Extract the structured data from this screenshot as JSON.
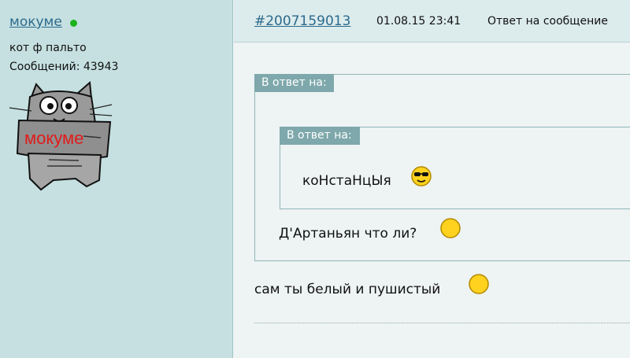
{
  "user": {
    "name": "мокуме",
    "title": "кот ф пальто",
    "posts": "Сообщений: 43943",
    "avatar_text": "мокуме"
  },
  "post": {
    "id": "#2007159013",
    "date": "01.08.15 23:41",
    "reply": "Ответ на сообщение"
  },
  "quotes": {
    "outer_label": "В ответ на:",
    "inner_label": "В ответ на:",
    "inner_text": "коНстаНцЫя",
    "outer_text": "Д'Артаньян что ли?"
  },
  "body_text": "сам ты белый и пушистый",
  "icons": {
    "online": "online-status-dot",
    "cool": "sunglasses-smiley-icon",
    "smile": "yellow-smiley-icon"
  },
  "colors": {
    "sidebar": "#c6e0e1",
    "link": "#2b6a8c",
    "quote_label": "#7ea8ab",
    "online": "#1bb31b"
  }
}
